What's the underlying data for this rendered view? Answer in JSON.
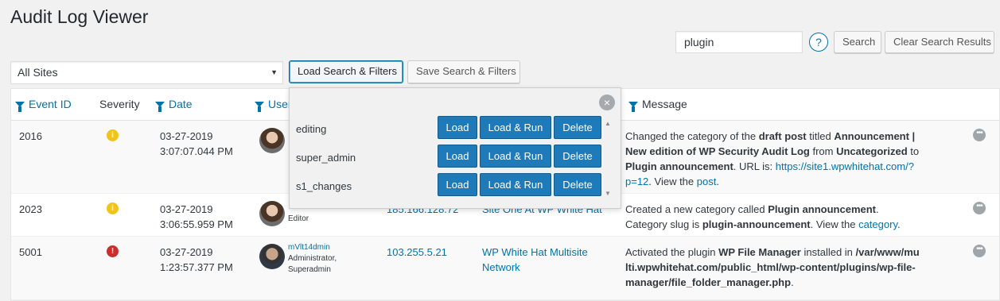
{
  "page": {
    "title": "Audit Log Viewer"
  },
  "search": {
    "value": "plugin",
    "help": "?",
    "search_label": "Search",
    "clear_label": "Clear Search Results"
  },
  "filters": {
    "site_selected": "All Sites",
    "load_label": "Load Search & Filters",
    "save_label": "Save Search & Filters"
  },
  "columns": {
    "event_id": "Event ID",
    "severity": "Severity",
    "date": "Date",
    "user": "User",
    "message": "Message"
  },
  "rows": [
    {
      "event_id": "2016",
      "severity": "info",
      "severity_glyph": "i",
      "date": "03-27-2019",
      "time": "3:07:07.044 PM",
      "message": {
        "p1": "Changed the category of the ",
        "b1": "draft post",
        "p2": " titled ",
        "b2": "Announcement | New edition of WP Security Audit Log",
        "p3": " from ",
        "b3": "Uncategorized",
        "p4": " to ",
        "b4": "Plugin announcement",
        "p5": ". URL is: ",
        "l1": "https://site1.wpwhitehat.com/?p=12",
        "p6": ". View the ",
        "l2": "post",
        "p7": "."
      }
    },
    {
      "event_id": "2023",
      "severity": "info",
      "severity_glyph": "i",
      "date": "03-27-2019",
      "time": "3:06:55.959 PM",
      "user_role": "Editor",
      "ip": "185.166.128.72",
      "site": "Site One At WP White Hat",
      "message": {
        "p1": "Created a new category called ",
        "b1": "Plugin announcement",
        "p2": ". Category slug is ",
        "b2": "plugin-announcement",
        "p3": ". View the ",
        "l1": "category",
        "p4": "."
      }
    },
    {
      "event_id": "5001",
      "severity": "critical",
      "severity_glyph": "!",
      "date": "03-27-2019",
      "time": "1:23:57.377 PM",
      "user_name": "mVlt14dmin",
      "user_role": "Administrator,",
      "user_role2": "Superadmin",
      "ip": "103.255.5.21",
      "site": "WP White Hat Multisite Network",
      "message": {
        "p1": "Activated the plugin ",
        "b1": "WP File Manager",
        "p2": " installed in ",
        "b2": "/var/www/multi.wpwhitehat.com/public_html/wp-content/plugins/wp-file-manager/file_folder_manager.php",
        "p3": "."
      }
    }
  ],
  "saved_filters": {
    "presets": [
      {
        "name": "editing"
      },
      {
        "name": "super_admin"
      },
      {
        "name": "s1_changes"
      }
    ],
    "load_label": "Load",
    "load_run_label": "Load & Run",
    "delete_label": "Delete",
    "close_glyph": "×"
  },
  "row_menu_glyph": "•••",
  "colors": {
    "link": "#0073aa",
    "primary_button": "#1e7ab8",
    "warning": "#f0c419",
    "critical": "#c9302c"
  }
}
